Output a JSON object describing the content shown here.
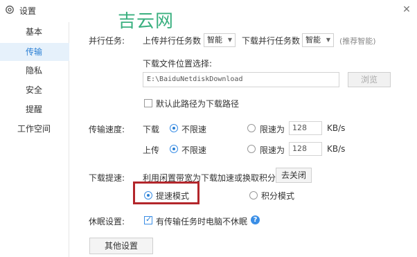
{
  "window": {
    "title": "设置",
    "watermark": "吉云网"
  },
  "sidebar": {
    "items": [
      {
        "label": "基本",
        "active": false
      },
      {
        "label": "传输",
        "active": true
      },
      {
        "label": "隐私",
        "active": false
      },
      {
        "label": "安全",
        "active": false
      },
      {
        "label": "提醒",
        "active": false
      },
      {
        "label": "工作空间",
        "active": false
      }
    ]
  },
  "parallel": {
    "label": "并行任务:",
    "upload_label": "上传并行任务数",
    "upload_value": "智能",
    "download_label": "下载并行任务数",
    "download_value": "智能",
    "hint": "(推荐智能)"
  },
  "download_location": {
    "label": "下载文件位置选择:",
    "path": "E:\\BaiduNetdiskDownload",
    "browse_label": "浏览",
    "default_checkbox_label": "默认此路径为下载路径",
    "default_checked": false
  },
  "speed": {
    "label": "传输速度:",
    "download": {
      "label": "下载",
      "unlimited_label": "不限速",
      "limit_label": "限速为",
      "limit_value": "128",
      "unit": "KB/s",
      "unlimited_selected": true
    },
    "upload": {
      "label": "上传",
      "unlimited_label": "不限速",
      "limit_label": "限速为",
      "limit_value": "128",
      "unit": "KB/s",
      "unlimited_selected": true
    }
  },
  "boost": {
    "label": "下载提速:",
    "description": "利用闲置带宽为下载加速或换取积分",
    "toggle_label": "去关闭",
    "mode_fast": "提速模式",
    "mode_points": "积分模式",
    "selected": "fast"
  },
  "sleep": {
    "label": "休眠设置:",
    "checkbox_label": "有传输任务时电脑不休眠",
    "checked": true
  },
  "other_button_label": "其他设置",
  "colors": {
    "accent": "#2a7fd4",
    "highlight_border": "#b3262b",
    "watermark": "#1aa36a"
  }
}
